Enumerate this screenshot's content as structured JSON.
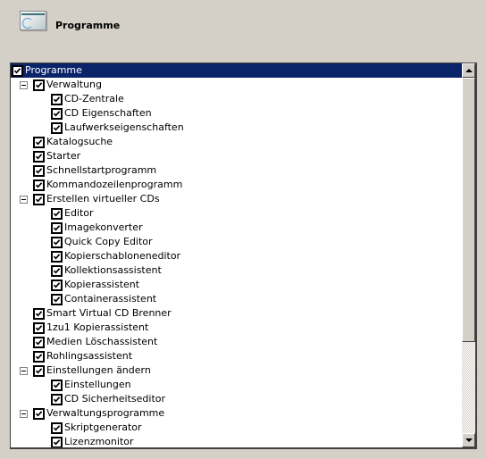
{
  "header": {
    "title": "Programme",
    "icon": "programs-window-icon"
  },
  "tree": {
    "items": [
      {
        "label": "Programme",
        "level": 0,
        "checked": true,
        "expander": null,
        "selected": true
      },
      {
        "label": "Verwaltung",
        "level": 1,
        "checked": true,
        "expander": "collapse"
      },
      {
        "label": "CD-Zentrale",
        "level": 2,
        "checked": true,
        "expander": null
      },
      {
        "label": "CD Eigenschaften",
        "level": 2,
        "checked": true,
        "expander": null
      },
      {
        "label": "Laufwerkseigenschaften",
        "level": 2,
        "checked": true,
        "expander": null
      },
      {
        "label": "Katalogsuche",
        "level": 1,
        "checked": true,
        "expander": null
      },
      {
        "label": "Starter",
        "level": 1,
        "checked": true,
        "expander": null
      },
      {
        "label": "Schnellstartprogramm",
        "level": 1,
        "checked": true,
        "expander": null
      },
      {
        "label": "Kommandozeilenprogramm",
        "level": 1,
        "checked": true,
        "expander": null
      },
      {
        "label": "Erstellen virtueller CDs",
        "level": 1,
        "checked": true,
        "expander": "collapse"
      },
      {
        "label": "Editor",
        "level": 2,
        "checked": true,
        "expander": null
      },
      {
        "label": "Imagekonverter",
        "level": 2,
        "checked": true,
        "expander": null
      },
      {
        "label": "Quick Copy Editor",
        "level": 2,
        "checked": true,
        "expander": null
      },
      {
        "label": "Kopierschabloneneditor",
        "level": 2,
        "checked": true,
        "expander": null
      },
      {
        "label": "Kollektionsassistent",
        "level": 2,
        "checked": true,
        "expander": null
      },
      {
        "label": "Kopierassistent",
        "level": 2,
        "checked": true,
        "expander": null
      },
      {
        "label": "Containerassistent",
        "level": 2,
        "checked": true,
        "expander": null
      },
      {
        "label": "Smart Virtual CD Brenner",
        "level": 1,
        "checked": true,
        "expander": null
      },
      {
        "label": "1zu1 Kopierassistent",
        "level": 1,
        "checked": true,
        "expander": null
      },
      {
        "label": "Medien Löschassistent",
        "level": 1,
        "checked": true,
        "expander": null
      },
      {
        "label": "Rohlingsassistent",
        "level": 1,
        "checked": true,
        "expander": null
      },
      {
        "label": "Einstellungen ändern",
        "level": 1,
        "checked": true,
        "expander": "collapse"
      },
      {
        "label": "Einstellungen",
        "level": 2,
        "checked": true,
        "expander": null
      },
      {
        "label": "CD Sicherheitseditor",
        "level": 2,
        "checked": true,
        "expander": null
      },
      {
        "label": "Verwaltungsprogramme",
        "level": 1,
        "checked": true,
        "expander": "collapse"
      },
      {
        "label": "Skriptgenerator",
        "level": 2,
        "checked": true,
        "expander": null
      },
      {
        "label": "Lizenzmonitor",
        "level": 2,
        "checked": true,
        "expander": null
      }
    ]
  },
  "scrollbar": {
    "position_fraction": 0.0,
    "visible_fraction": 0.73
  },
  "colors": {
    "selection": "#0a246a",
    "background": "#d4d0c8"
  }
}
